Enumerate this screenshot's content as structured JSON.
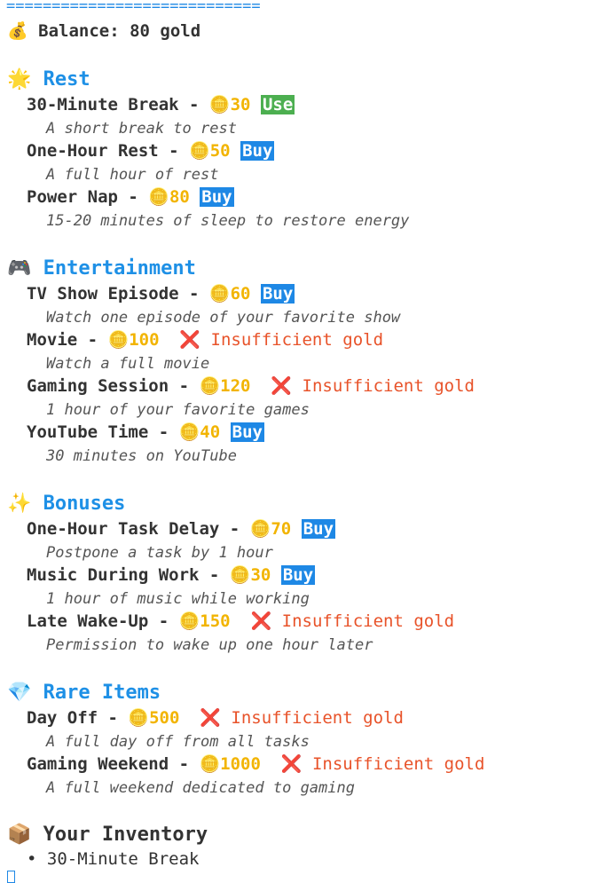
{
  "separator": "============================",
  "balance": {
    "icon": "💰",
    "text": "Balance: 80 gold"
  },
  "coin_icon": "🪙",
  "insufficient_icon": "❌",
  "insufficient_text": "Insufficient gold",
  "use_label": "Use",
  "buy_label": "Buy",
  "sections": [
    {
      "icon": "🌟",
      "title": "Rest",
      "items": [
        {
          "name": "30-Minute Break",
          "price": "30",
          "action": "Use",
          "desc": "A short break to rest"
        },
        {
          "name": "One-Hour Rest",
          "price": "50",
          "action": "Buy",
          "desc": "A full hour of rest"
        },
        {
          "name": "Power Nap",
          "price": "80",
          "action": "Buy",
          "desc": "15-20 minutes of sleep to restore energy"
        }
      ]
    },
    {
      "icon": "🎮",
      "title": "Entertainment",
      "items": [
        {
          "name": "TV Show Episode",
          "price": "60",
          "action": "Buy",
          "desc": "Watch one episode of your favorite show"
        },
        {
          "name": "Movie",
          "price": "100",
          "action": "Insufficient",
          "desc": "Watch a full movie"
        },
        {
          "name": "Gaming Session",
          "price": "120",
          "action": "Insufficient",
          "desc": "1 hour of your favorite games"
        },
        {
          "name": "YouTube Time",
          "price": "40",
          "action": "Buy",
          "desc": "30 minutes on YouTube"
        }
      ]
    },
    {
      "icon": "✨",
      "title": "Bonuses",
      "items": [
        {
          "name": "One-Hour Task Delay",
          "price": "70",
          "action": "Buy",
          "desc": "Postpone a task by 1 hour"
        },
        {
          "name": "Music During Work",
          "price": "30",
          "action": "Buy",
          "desc": "1 hour of music while working"
        },
        {
          "name": "Late Wake-Up",
          "price": "150",
          "action": "Insufficient",
          "desc": "Permission to wake up one hour later"
        }
      ]
    },
    {
      "icon": "💎",
      "title": "Rare Items",
      "items": [
        {
          "name": "Day Off",
          "price": "500",
          "action": "Insufficient",
          "desc": "A full day off from all tasks"
        },
        {
          "name": "Gaming Weekend",
          "price": "1000",
          "action": "Insufficient",
          "desc": "A full weekend dedicated to gaming"
        }
      ]
    }
  ],
  "inventory": {
    "icon": "📦",
    "title": "Your Inventory",
    "bullet": "•",
    "items": [
      "30-Minute Break"
    ]
  }
}
